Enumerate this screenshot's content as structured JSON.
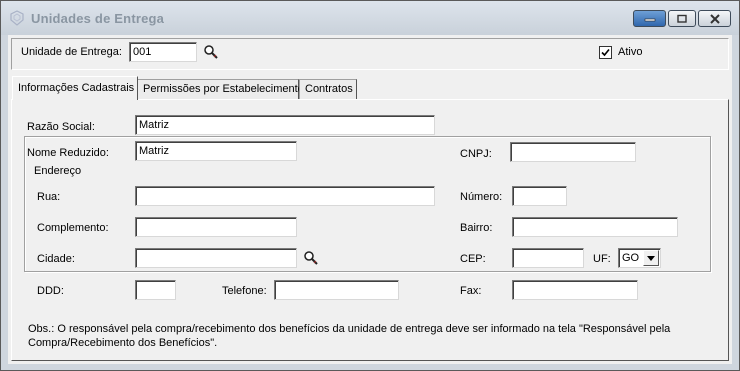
{
  "window": {
    "title": "Unidades de Entrega"
  },
  "header": {
    "unidade_label": "Unidade de Entrega:",
    "unidade_value": "001",
    "ativo_label": "Ativo",
    "ativo_checked": true
  },
  "tabs": [
    {
      "label": "Informações Cadastrais",
      "active": true
    },
    {
      "label": "Permissões por Estabelecimento",
      "active": false
    },
    {
      "label": "Contratos",
      "active": false
    }
  ],
  "form": {
    "razao_social_label": "Razão Social:",
    "razao_social_value": "Matriz",
    "nome_reduzido_label": "Nome Reduzido:",
    "nome_reduzido_value": "Matriz",
    "cnpj_label": "CNPJ:",
    "cnpj_value": "",
    "endereco_title": "Endereço",
    "rua_label": "Rua:",
    "rua_value": "",
    "numero_label": "Número:",
    "numero_value": "",
    "complemento_label": "Complemento:",
    "complemento_value": "",
    "bairro_label": "Bairro:",
    "bairro_value": "",
    "cidade_label": "Cidade:",
    "cidade_value": "",
    "cep_label": "CEP:",
    "cep_value": "",
    "uf_label": "UF:",
    "uf_value": "GO",
    "ddd_label": "DDD:",
    "ddd_value": "",
    "telefone_label": "Telefone:",
    "telefone_value": "",
    "fax_label": "Fax:",
    "fax_value": ""
  },
  "obs_text": "Obs.: O responsável pela compra/recebimento dos benefícios da unidade de entrega deve ser informado na tela \"Responsável pela Compra/Recebimento dos Benefícios\"."
}
